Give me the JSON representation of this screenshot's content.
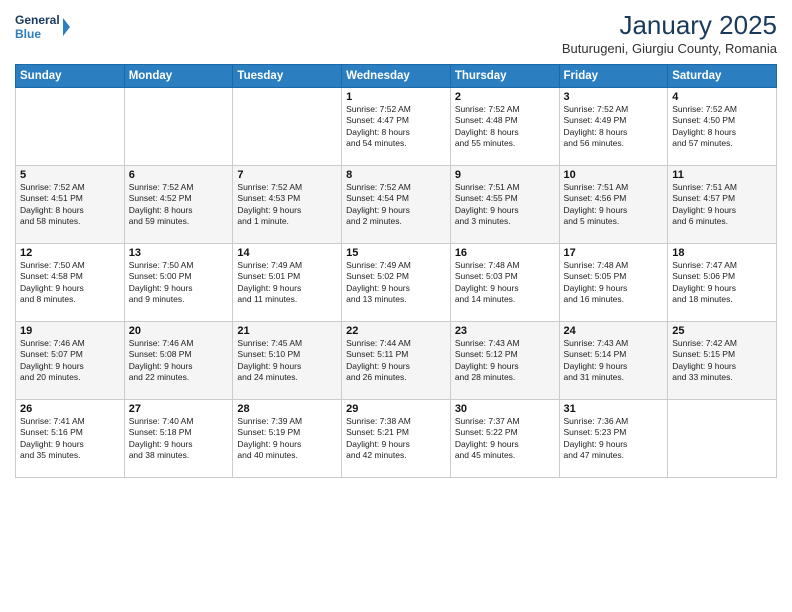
{
  "header": {
    "logo_line1": "General",
    "logo_line2": "Blue",
    "month": "January 2025",
    "location": "Buturugeni, Giurgiu County, Romania"
  },
  "days": [
    "Sunday",
    "Monday",
    "Tuesday",
    "Wednesday",
    "Thursday",
    "Friday",
    "Saturday"
  ],
  "weeks": [
    [
      {
        "day": "",
        "content": ""
      },
      {
        "day": "",
        "content": ""
      },
      {
        "day": "",
        "content": ""
      },
      {
        "day": "1",
        "content": "Sunrise: 7:52 AM\nSunset: 4:47 PM\nDaylight: 8 hours\nand 54 minutes."
      },
      {
        "day": "2",
        "content": "Sunrise: 7:52 AM\nSunset: 4:48 PM\nDaylight: 8 hours\nand 55 minutes."
      },
      {
        "day": "3",
        "content": "Sunrise: 7:52 AM\nSunset: 4:49 PM\nDaylight: 8 hours\nand 56 minutes."
      },
      {
        "day": "4",
        "content": "Sunrise: 7:52 AM\nSunset: 4:50 PM\nDaylight: 8 hours\nand 57 minutes."
      }
    ],
    [
      {
        "day": "5",
        "content": "Sunrise: 7:52 AM\nSunset: 4:51 PM\nDaylight: 8 hours\nand 58 minutes."
      },
      {
        "day": "6",
        "content": "Sunrise: 7:52 AM\nSunset: 4:52 PM\nDaylight: 8 hours\nand 59 minutes."
      },
      {
        "day": "7",
        "content": "Sunrise: 7:52 AM\nSunset: 4:53 PM\nDaylight: 9 hours\nand 1 minute."
      },
      {
        "day": "8",
        "content": "Sunrise: 7:52 AM\nSunset: 4:54 PM\nDaylight: 9 hours\nand 2 minutes."
      },
      {
        "day": "9",
        "content": "Sunrise: 7:51 AM\nSunset: 4:55 PM\nDaylight: 9 hours\nand 3 minutes."
      },
      {
        "day": "10",
        "content": "Sunrise: 7:51 AM\nSunset: 4:56 PM\nDaylight: 9 hours\nand 5 minutes."
      },
      {
        "day": "11",
        "content": "Sunrise: 7:51 AM\nSunset: 4:57 PM\nDaylight: 9 hours\nand 6 minutes."
      }
    ],
    [
      {
        "day": "12",
        "content": "Sunrise: 7:50 AM\nSunset: 4:58 PM\nDaylight: 9 hours\nand 8 minutes."
      },
      {
        "day": "13",
        "content": "Sunrise: 7:50 AM\nSunset: 5:00 PM\nDaylight: 9 hours\nand 9 minutes."
      },
      {
        "day": "14",
        "content": "Sunrise: 7:49 AM\nSunset: 5:01 PM\nDaylight: 9 hours\nand 11 minutes."
      },
      {
        "day": "15",
        "content": "Sunrise: 7:49 AM\nSunset: 5:02 PM\nDaylight: 9 hours\nand 13 minutes."
      },
      {
        "day": "16",
        "content": "Sunrise: 7:48 AM\nSunset: 5:03 PM\nDaylight: 9 hours\nand 14 minutes."
      },
      {
        "day": "17",
        "content": "Sunrise: 7:48 AM\nSunset: 5:05 PM\nDaylight: 9 hours\nand 16 minutes."
      },
      {
        "day": "18",
        "content": "Sunrise: 7:47 AM\nSunset: 5:06 PM\nDaylight: 9 hours\nand 18 minutes."
      }
    ],
    [
      {
        "day": "19",
        "content": "Sunrise: 7:46 AM\nSunset: 5:07 PM\nDaylight: 9 hours\nand 20 minutes."
      },
      {
        "day": "20",
        "content": "Sunrise: 7:46 AM\nSunset: 5:08 PM\nDaylight: 9 hours\nand 22 minutes."
      },
      {
        "day": "21",
        "content": "Sunrise: 7:45 AM\nSunset: 5:10 PM\nDaylight: 9 hours\nand 24 minutes."
      },
      {
        "day": "22",
        "content": "Sunrise: 7:44 AM\nSunset: 5:11 PM\nDaylight: 9 hours\nand 26 minutes."
      },
      {
        "day": "23",
        "content": "Sunrise: 7:43 AM\nSunset: 5:12 PM\nDaylight: 9 hours\nand 28 minutes."
      },
      {
        "day": "24",
        "content": "Sunrise: 7:43 AM\nSunset: 5:14 PM\nDaylight: 9 hours\nand 31 minutes."
      },
      {
        "day": "25",
        "content": "Sunrise: 7:42 AM\nSunset: 5:15 PM\nDaylight: 9 hours\nand 33 minutes."
      }
    ],
    [
      {
        "day": "26",
        "content": "Sunrise: 7:41 AM\nSunset: 5:16 PM\nDaylight: 9 hours\nand 35 minutes."
      },
      {
        "day": "27",
        "content": "Sunrise: 7:40 AM\nSunset: 5:18 PM\nDaylight: 9 hours\nand 38 minutes."
      },
      {
        "day": "28",
        "content": "Sunrise: 7:39 AM\nSunset: 5:19 PM\nDaylight: 9 hours\nand 40 minutes."
      },
      {
        "day": "29",
        "content": "Sunrise: 7:38 AM\nSunset: 5:21 PM\nDaylight: 9 hours\nand 42 minutes."
      },
      {
        "day": "30",
        "content": "Sunrise: 7:37 AM\nSunset: 5:22 PM\nDaylight: 9 hours\nand 45 minutes."
      },
      {
        "day": "31",
        "content": "Sunrise: 7:36 AM\nSunset: 5:23 PM\nDaylight: 9 hours\nand 47 minutes."
      },
      {
        "day": "",
        "content": ""
      }
    ]
  ]
}
